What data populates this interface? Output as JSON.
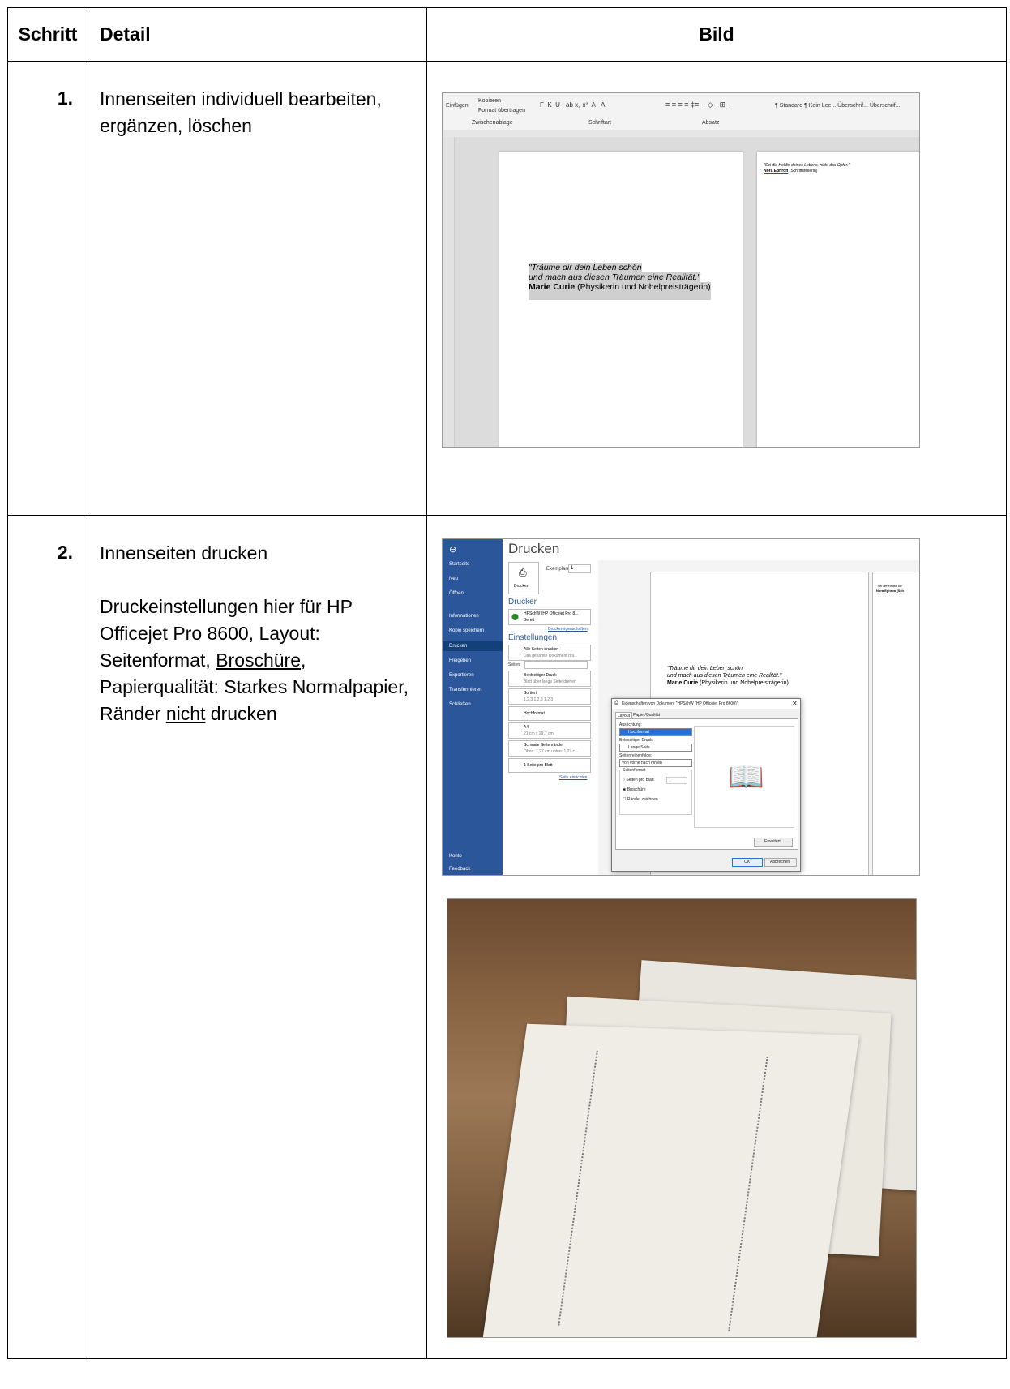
{
  "table": {
    "headers": {
      "step": "Schritt",
      "detail": "Detail",
      "image": "Bild"
    }
  },
  "rows": [
    {
      "number": "1.",
      "detail": "Innenseiten individuell bearbeiten, ergänzen, löschen"
    },
    {
      "number": "2.",
      "detail_line1": "Innenseiten drucken",
      "detail_p2_a": "Druckeinstellungen hier für HP Officejet Pro 8600, Layout: Seitenformat, ",
      "detail_p2_u1": "Broschüre",
      "detail_p2_b": ", Papierqualität: Starkes Normalpapier, Ränder ",
      "detail_p2_u2": "nicht",
      "detail_p2_c": " drucken"
    }
  ],
  "word_screenshot": {
    "ribbon": {
      "paste": "Einfügen",
      "copy": "Kopieren",
      "format_painter": "Format übertragen",
      "clipboard": "Zwischenablage",
      "font_group": "Schriftart",
      "paragraph_group": "Absatz",
      "styles": "¶ Standard   ¶ Kein Lee...  Überschrif...  Überschrif..."
    },
    "quote_left_line1": "\"Träume dir dein Leben schön",
    "quote_left_line2": "und mach aus diesen Träumen eine Realität.\"",
    "quote_left_author": "Marie Curie",
    "quote_left_role": " (Physikerin und Nobelpreisträgerin)",
    "quote_right_line1": "\"Sei die Heldin deines Lebens, nicht das Opfer.\"",
    "quote_right_author": "Nora Ephron",
    "quote_right_role": " (Schriftstellerin)"
  },
  "print_screenshot": {
    "nav": [
      "Startseite",
      "Neu",
      "Öffnen",
      "Informationen",
      "Kopie speichern",
      "Drucken",
      "Freigeben",
      "Exportieren",
      "Transformieren",
      "Schließen",
      "Konto",
      "Feedback"
    ],
    "title": "Drucken",
    "copies_label": "Exemplare:",
    "copies_value": "1",
    "print_button": "Drucken",
    "printer_header": "Drucker",
    "printer_name": "HPSchW (HP Officejet Pro 8...",
    "printer_status": "Bereit",
    "printer_props": "Druckereigenschaften",
    "settings_header": "Einstellungen",
    "settings": [
      {
        "line1": "Alle Seiten drucken",
        "line2": "Das gesamte Dokument dru..."
      },
      {
        "line1": "Beidseitiger Druck",
        "line2": "Blatt über lange Seite drehen"
      },
      {
        "line1": "Sortiert",
        "line2": "1,2,3   1,2,3   1,2,3"
      },
      {
        "line1": "Hochformat",
        "line2": ""
      },
      {
        "line1": "A4",
        "line2": "21 cm x 29,7 cm"
      },
      {
        "line1": "Schmale Seitenränder",
        "line2": "Oben: 1,27 cm unten: 1,27 c..."
      },
      {
        "line1": "1 Seite pro Blatt",
        "line2": ""
      }
    ],
    "pages_label": "Seiten:",
    "page_setup": "Seite einrichten",
    "preview_line1": "\"Träume dir dein Leben schön",
    "preview_line2": "und mach aus diesen Träumen eine Realität.\"",
    "preview_author": "Marie Curie",
    "preview_role": " (Physikerin und Nobelpreisträgerin)",
    "preview_right1": "\"Sei die Heldin de",
    "preview_right2": "Nora Ephron (Sch",
    "dialog": {
      "title": "Eigenschaften von Dokument \"HPSchW (HP Officejet Pro 8600)\"",
      "tab_layout": "Layout",
      "tab_paper": "Papier/Qualität",
      "orientation_label": "Ausrichtung:",
      "orientation_value": "Hochformat",
      "duplex_label": "Beidseitiger Druck:",
      "duplex_value": "Lange Seite",
      "order_label": "Seitenreihenfolge:",
      "order_value": "Von vorne nach hinten",
      "format_label": "Seitenformat",
      "pages_per_sheet": "Seiten pro Blatt",
      "pages_per_sheet_value": "1",
      "booklet": "Broschüre",
      "draw_borders": "Ränder zeichnen",
      "advanced": "Erweitert...",
      "ok": "OK",
      "cancel": "Abbrechen"
    }
  }
}
